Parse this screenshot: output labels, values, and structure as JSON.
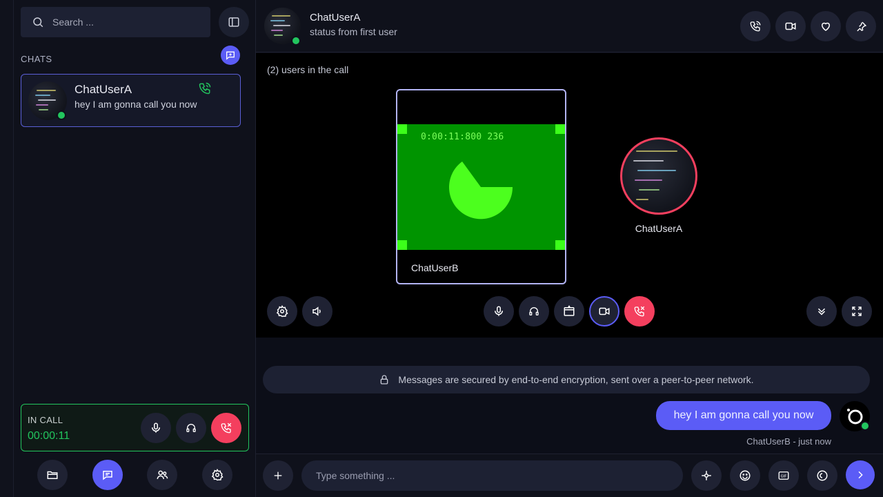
{
  "search": {
    "placeholder": "Search ..."
  },
  "sidebar": {
    "chats_title": "CHATS",
    "chats": [
      {
        "name": "ChatUserA",
        "last_message": "hey I am gonna call you now",
        "online": true,
        "in_call": true
      }
    ],
    "in_call_card": {
      "label": "IN CALL",
      "duration": "00:00:11"
    },
    "nav_items": [
      {
        "icon": "folder-icon"
      },
      {
        "icon": "chat-icon",
        "active": true
      },
      {
        "icon": "users-icon"
      },
      {
        "icon": "settings-icon"
      }
    ]
  },
  "header": {
    "name": "ChatUserA",
    "status": "status from first user"
  },
  "call": {
    "users_count": "(2) users in the call",
    "local_user": "ChatUserB",
    "timecode": "0:00:11:800 236",
    "remote_user": "ChatUserA"
  },
  "messages": {
    "encryption_notice": "Messages are secured by end-to-end encryption, sent over a peer-to-peer network.",
    "items": [
      {
        "text": "hey I am gonna call you now",
        "sender": "ChatUserB",
        "time": "just now",
        "meta": "ChatUserB - just now"
      }
    ]
  },
  "composer": {
    "placeholder": "Type something ..."
  },
  "colors": {
    "accent": "#5b5cf6",
    "online": "#22c55e",
    "danger": "#f43f5e",
    "video_bg": "#009400"
  }
}
